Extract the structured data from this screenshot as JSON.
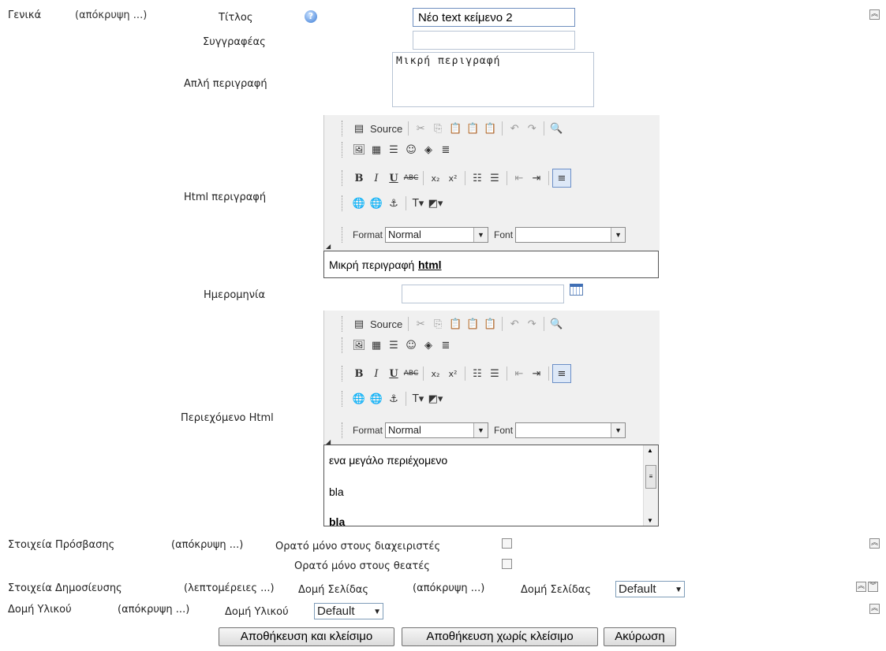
{
  "general": {
    "section": "Γενικά",
    "toggle": "(απόκρυψη ...)",
    "title_label": "Τίτλος",
    "title_value": "Νέο text κείμενο 2",
    "author_label": "Συγγραφέας",
    "author_value": "",
    "simple_desc_label": "Απλή περιγραφή",
    "simple_desc_value": "Μικρή περιγραφή",
    "html_desc_label": "Html περιγραφή",
    "html_desc_text": "Μικρή περιγραφή ",
    "html_desc_link": "html",
    "date_label": "Ημερομηνία",
    "date_value": "",
    "content_label": "Περιεχόμενο Html",
    "content_lines": [
      "ενα μεγάλο περιέχομενο",
      "bla",
      "bla"
    ]
  },
  "editor": {
    "source": "Source",
    "format_label": "Format",
    "format_value": "Normal",
    "font_label": "Font",
    "font_value": ""
  },
  "access": {
    "section": "Στοιχεία Πρόσβασης",
    "toggle": "(απόκρυψη ...)",
    "admins_only": "Ορατό μόνο στους διαχειριστές",
    "viewers_only": "Ορατό μόνο στους θεατές"
  },
  "publish": {
    "section": "Στοιχεία Δημοσίευσης",
    "toggle": "(λεπτομέρειες ...)",
    "page_structure_section": "Δομή Σελίδας",
    "page_structure_toggle": "(απόκρυψη ...)",
    "page_structure_label": "Δομή Σελίδας",
    "page_structure_value": "Default"
  },
  "material": {
    "section": "Δομή Υλικού",
    "toggle": "(απόκρυψη ...)",
    "label": "Δομή Υλικού",
    "value": "Default"
  },
  "buttons": {
    "save_close": "Αποθήκευση και κλείσιμο",
    "save_no_close": "Αποθήκευση χωρίς κλείσιμο",
    "cancel": "Ακύρωση"
  },
  "icons": {
    "collapse": "collapse-up-icon",
    "expand": "expand-down-icon",
    "help": "help-icon",
    "calendar": "calendar-icon"
  }
}
